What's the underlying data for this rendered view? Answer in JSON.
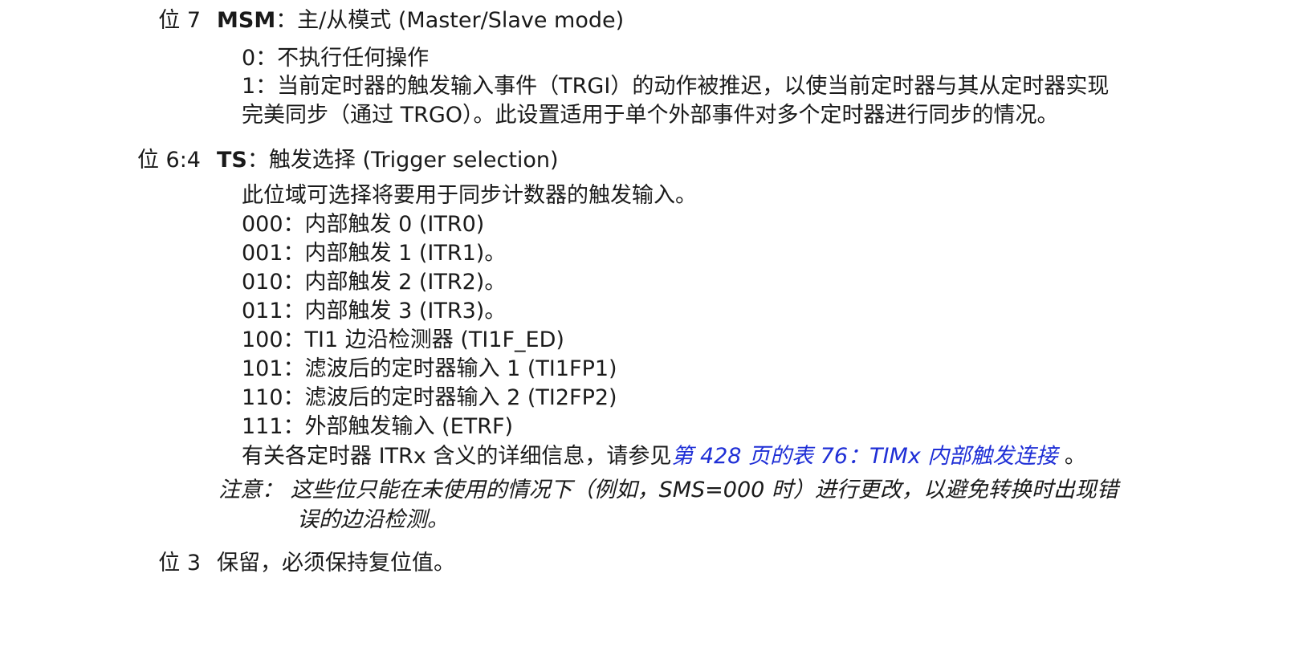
{
  "bit7": {
    "label": "位 7",
    "name": "MSM",
    "title": "：主/从模式 (Master/Slave mode)",
    "lines": [
      "0：不执行任何操作",
      "1：当前定时器的触发输入事件（TRGI）的动作被推迟，以使当前定时器与其从定时器实现",
      "完美同步（通过 TRGO）。此设置适用于单个外部事件对多个定时器进行同步的情况。"
    ]
  },
  "bit64": {
    "label": "位 6:4",
    "name": "TS",
    "title": "：触发选择 (Trigger selection)",
    "lines": [
      "此位域可选择将要用于同步计数器的触发输入。",
      "000：内部触发 0 (ITR0)",
      "001：内部触发 1 (ITR1)。",
      "010：内部触发 2 (ITR2)。",
      "011：内部触发 3 (ITR3)。",
      "100：TI1 边沿检测器 (TI1F_ED)",
      "101：滤波后的定时器输入 1 (TI1FP1)",
      "110：滤波后的定时器输入 2 (TI2FP2)",
      "111：外部触发输入 (ETRF)"
    ],
    "ref_prefix": "有关各定时器 ITRx 含义的详细信息，请参见",
    "ref_link": "第 428 页的表 76：TIMx 内部触发连接",
    "ref_suffix": " 。",
    "note_line1": "注意：  这些位只能在未使用的情况下（例如，SMS=000   时）进行更改，以避免转换时出现错",
    "note_line2": "误的边沿检测。"
  },
  "bit3": {
    "label": "位 3",
    "text": "保留，必须保持复位值。"
  }
}
